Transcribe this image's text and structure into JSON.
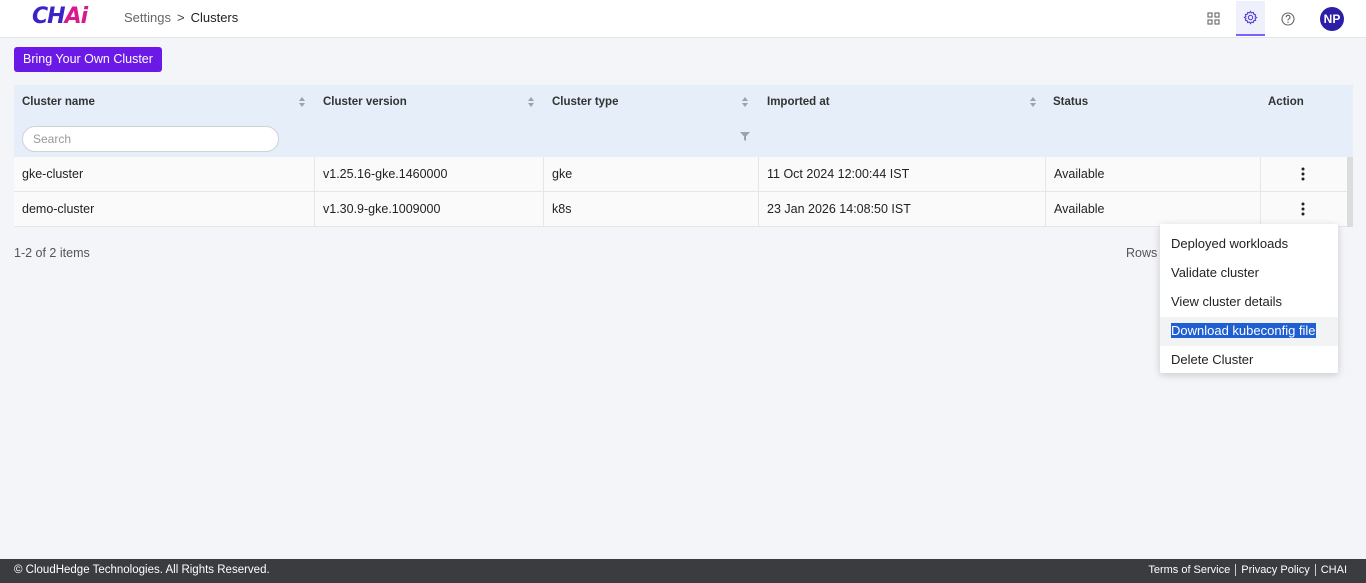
{
  "header": {
    "logo_main": "CH",
    "logo_accent": "Ai",
    "breadcrumb": [
      "Settings",
      "Clusters"
    ],
    "breadcrumb_sep": ">",
    "avatar": "NP"
  },
  "toolbar": {
    "byoc_label": "Bring Your Own Cluster"
  },
  "table": {
    "columns": [
      "Cluster name",
      "Cluster version",
      "Cluster type",
      "Imported at",
      "Status",
      "Action"
    ],
    "search_placeholder": "Search",
    "rows": [
      {
        "name": "gke-cluster",
        "version": "v1.25.16-gke.1460000",
        "type": "gke",
        "imported": "11 Oct 2024 12:00:44 IST",
        "status": "Available"
      },
      {
        "name": "demo-cluster",
        "version": "v1.30.9-gke.1009000",
        "type": "k8s",
        "imported": "23 Jan 2026 14:08:50 IST",
        "status": "Available"
      }
    ]
  },
  "pager": {
    "info": "1-2 of 2 items",
    "rows_label": "Rows"
  },
  "menu": {
    "items": [
      "Deployed workloads",
      "Validate cluster",
      "View cluster details",
      "Download kubeconfig file",
      "Delete Cluster"
    ]
  },
  "footer": {
    "copyright": "© CloudHedge Technologies. All Rights Reserved.",
    "links": [
      "Terms of Service",
      "Privacy Policy",
      "CHAI"
    ]
  },
  "colors": {
    "primary": "#6a19e6",
    "header_bg": "#e5eef9",
    "avatar_bg": "#2d1ea8",
    "footer_bg": "#3b3c40"
  }
}
